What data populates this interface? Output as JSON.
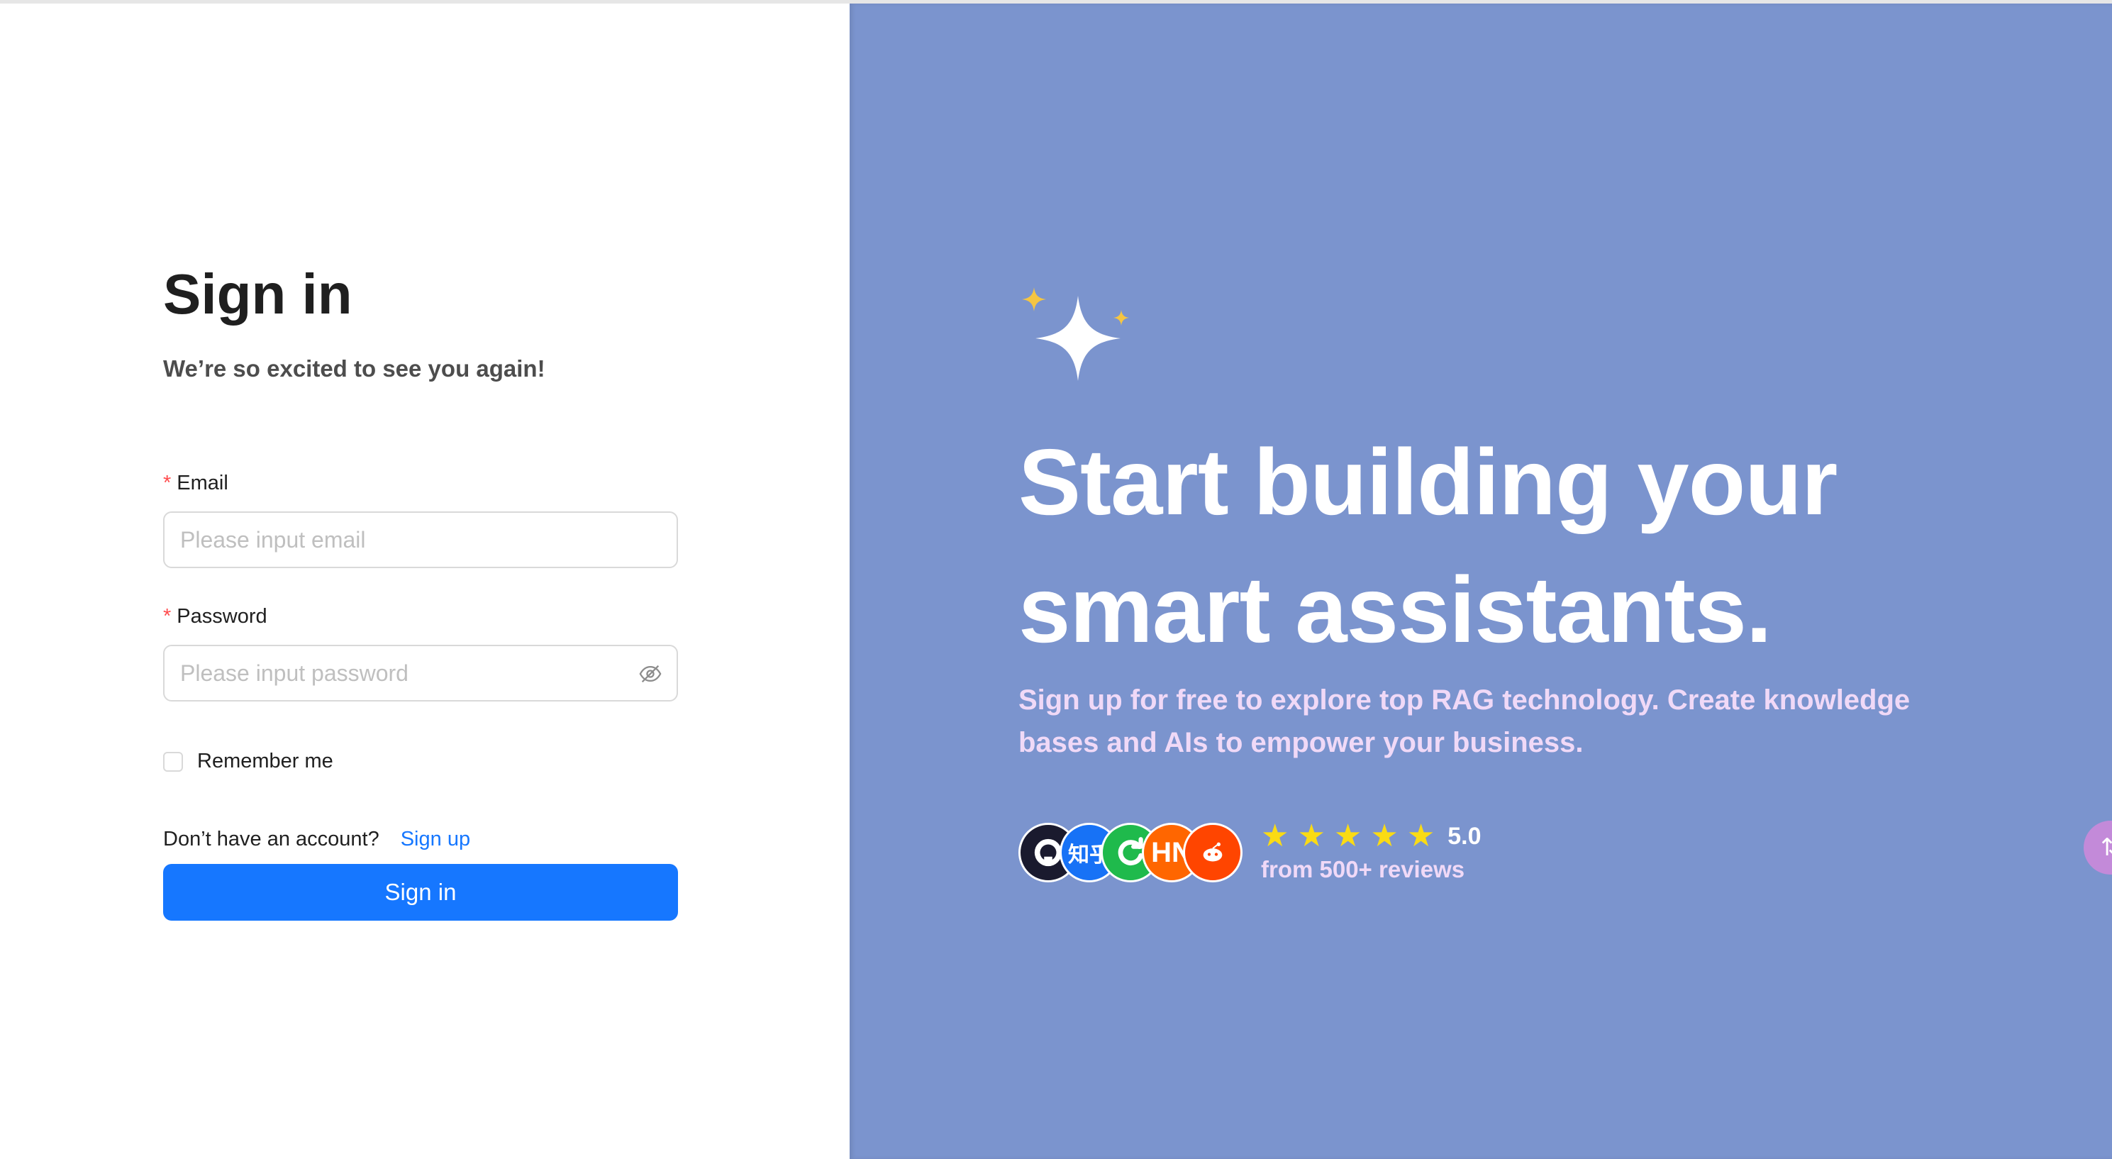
{
  "signin": {
    "title": "Sign in",
    "subtitle": "We’re so excited to see you again!",
    "email": {
      "required_mark": "*",
      "label": "Email",
      "value": "",
      "placeholder": "Please input email"
    },
    "password": {
      "required_mark": "*",
      "label": "Password",
      "value": "",
      "placeholder": "Please input password",
      "toggle_icon": "eye-invisible-icon"
    },
    "remember_label": "Remember me",
    "remember_checked": false,
    "no_account_text": "Don’t have an account?",
    "signup_link": "Sign up",
    "submit_label": "Sign in"
  },
  "hero": {
    "headline": "Start building your smart assistants.",
    "description": "Sign up for free to explore top RAG technology. Create knowledge bases and AIs to empower your business.",
    "avatars": [
      {
        "name": "github-avatar",
        "glyph": "",
        "color": "#1a1a2e"
      },
      {
        "name": "zhihu-avatar",
        "glyph": "知乎",
        "color": "#1772f6"
      },
      {
        "name": "green-brand-avatar",
        "glyph": "",
        "color": "#1fba4c"
      },
      {
        "name": "hacker-news-avatar",
        "glyph": "HN",
        "color": "#ff6600"
      },
      {
        "name": "reddit-avatar",
        "glyph": "",
        "color": "#ff4500"
      }
    ],
    "stars": 5,
    "rating_value": "5.0",
    "reviews_text": "from 500+ reviews",
    "float_button_glyph": "⇅"
  },
  "colors": {
    "primary": "#1677ff",
    "hero_bg": "#7b94ce",
    "star": "#fadb14",
    "required": "#ff4d4f",
    "hero_accent_text": "#f0d9f7"
  }
}
